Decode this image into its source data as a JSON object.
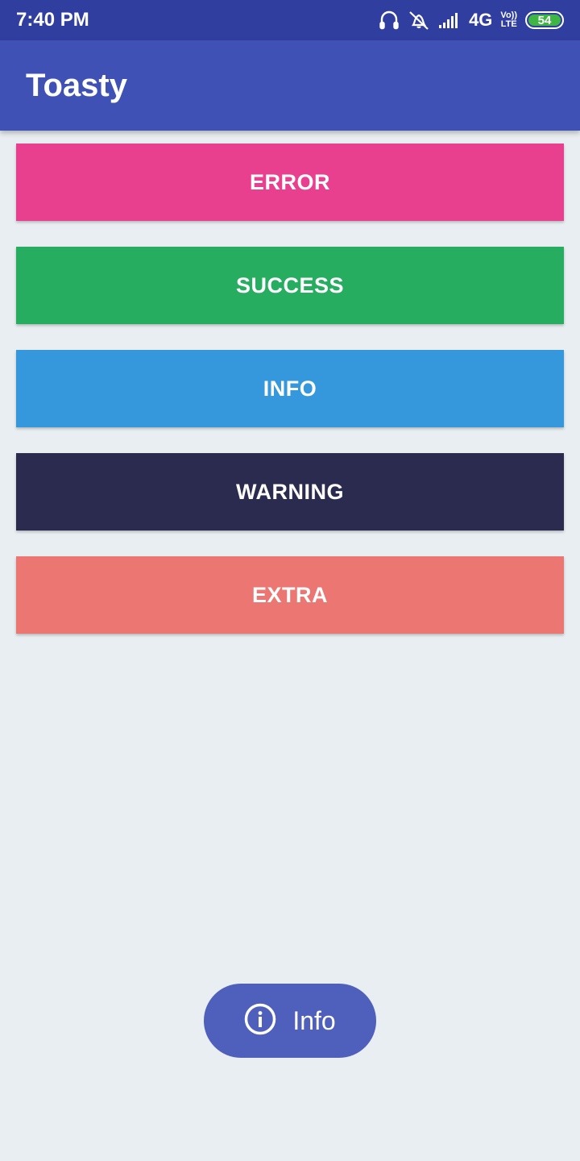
{
  "status_bar": {
    "time": "7:40 PM",
    "network": "4G",
    "volte_top": "Vo))",
    "volte_bottom": "LTE",
    "battery": "54",
    "icons": [
      "headset-icon",
      "vibrate-off-icon",
      "signal-icon",
      "battery-icon"
    ]
  },
  "app_bar": {
    "title": "Toasty",
    "color": "#3f51b5"
  },
  "buttons": [
    {
      "label": "ERROR",
      "color": "#e8408f"
    },
    {
      "label": "SUCCESS",
      "color": "#26ad60"
    },
    {
      "label": "INFO",
      "color": "#3598dc"
    },
    {
      "label": "WARNING",
      "color": "#2b2b4f"
    },
    {
      "label": "EXTRA",
      "color": "#ec7671"
    }
  ],
  "toast": {
    "text": "Info",
    "icon": "info-icon",
    "color": "#4f5fbc"
  }
}
